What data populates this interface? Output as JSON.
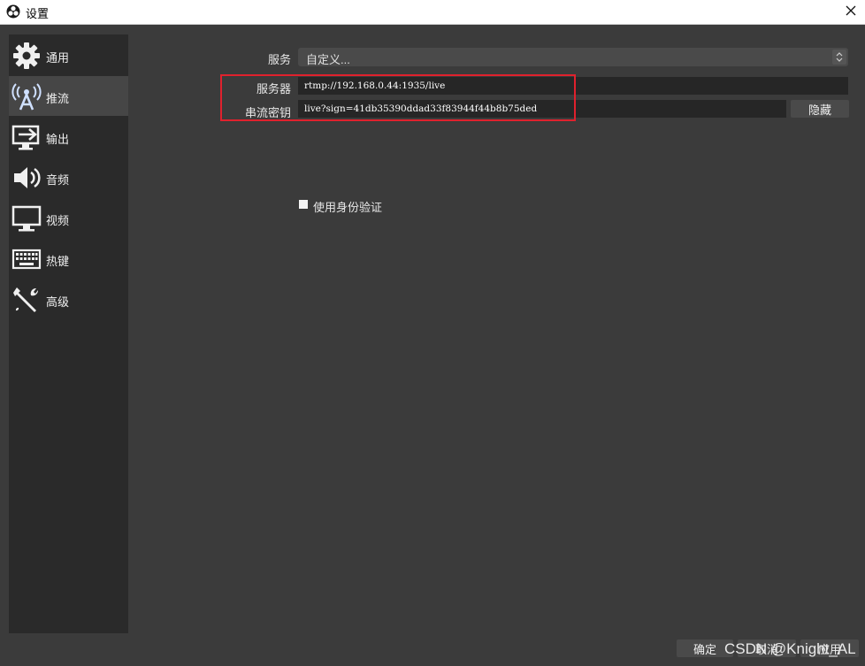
{
  "window": {
    "title": "设置",
    "icons": {
      "app": "obs-logo-icon",
      "close": "close-icon"
    }
  },
  "sidebar": {
    "items": [
      {
        "label": "通用",
        "icon": "gear-icon",
        "active": false
      },
      {
        "label": "推流",
        "icon": "broadcast-antenna-icon",
        "active": true
      },
      {
        "label": "输出",
        "icon": "output-monitor-arrow-icon",
        "active": false
      },
      {
        "label": "音频",
        "icon": "speaker-icon",
        "active": false
      },
      {
        "label": "视频",
        "icon": "monitor-icon",
        "active": false
      },
      {
        "label": "热键",
        "icon": "keyboard-icon",
        "active": false
      },
      {
        "label": "高级",
        "icon": "wrench-screwdriver-icon",
        "active": false
      }
    ]
  },
  "stream": {
    "service_label": "服务",
    "service_value": "自定义...",
    "server_label": "服务器",
    "server_value": "rtmp://192.168.0.44:1935/live",
    "key_label": "串流密钥",
    "key_value": "live?sign=41db35390ddad33f83944f44b8b75ded",
    "hide_button": "隐藏",
    "auth_checkbox_label": "使用身份验证",
    "auth_checked": false
  },
  "footer": {
    "ok": "确定",
    "cancel": "取消",
    "apply": "应用"
  },
  "watermark": "CSDN @Knight_AL",
  "colors": {
    "highlight_box": "#e0212d",
    "background": "#3b3b3b",
    "sidebar": "#2a2a2a"
  }
}
